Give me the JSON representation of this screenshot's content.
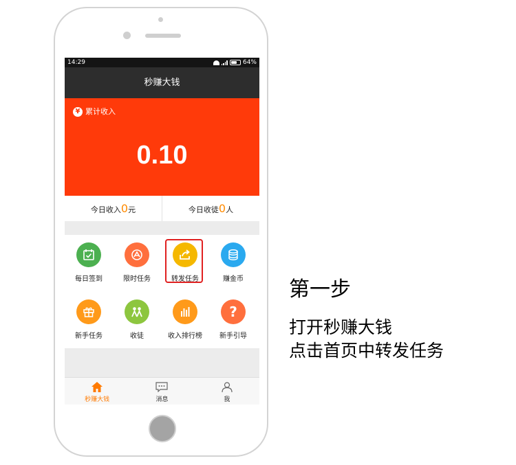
{
  "status_bar": {
    "time": "14:29",
    "battery": "64%"
  },
  "app": {
    "title": "秒赚大钱"
  },
  "income": {
    "label": "累计收入",
    "value": "0.10",
    "currency_icon": "yen-icon"
  },
  "stats": {
    "today_income_label": "今日收入",
    "today_income_value": "0",
    "today_income_unit": "元",
    "today_recruit_label": "今日收徒",
    "today_recruit_value": "0",
    "today_recruit_unit": "人"
  },
  "grid": [
    {
      "label": "每日签到",
      "icon": "calendar-check-icon",
      "color": "#4cb050"
    },
    {
      "label": "限时任务",
      "icon": "timer-icon",
      "color": "#ff6f3d"
    },
    {
      "label": "转发任务",
      "icon": "share-icon",
      "color": "#f5b800"
    },
    {
      "label": "赚金币",
      "icon": "coins-icon",
      "color": "#2aa9ef"
    },
    {
      "label": "新手任务",
      "icon": "gift-icon",
      "color": "#ff9a1a"
    },
    {
      "label": "收徒",
      "icon": "people-icon",
      "color": "#8dc63f"
    },
    {
      "label": "收入排行榜",
      "icon": "bar-chart-icon",
      "color": "#ff9a1a"
    },
    {
      "label": "新手引导",
      "icon": "question-icon",
      "color": "#ff6f3d"
    }
  ],
  "tabs": [
    {
      "label": "秒赚大钱",
      "icon": "home-icon"
    },
    {
      "label": "消息",
      "icon": "message-icon"
    },
    {
      "label": "我",
      "icon": "user-icon"
    }
  ],
  "caption": {
    "title": "第一步",
    "line1": "打开秒赚大钱",
    "line2": "点击首页中转发任务"
  },
  "colors": {
    "accent": "#ff3a0a",
    "highlight": "#e02020",
    "stat_number": "#ff8a00"
  }
}
